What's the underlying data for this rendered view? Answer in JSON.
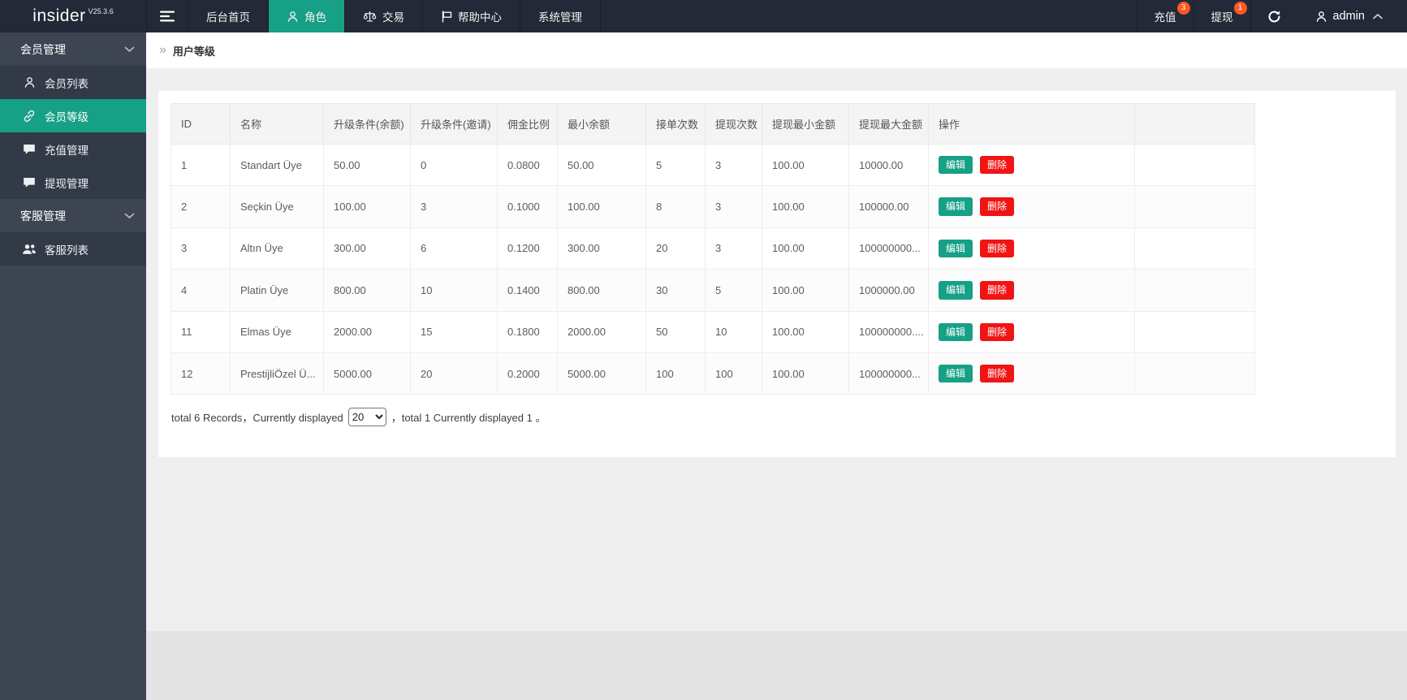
{
  "topbar": {
    "logo_text": "insider",
    "version": "V25.3.6",
    "nav": [
      {
        "label": "后台首页"
      },
      {
        "label": "角色",
        "active": true
      },
      {
        "label": "交易"
      },
      {
        "label": "帮助中心"
      },
      {
        "label": "系统管理"
      }
    ],
    "actions": [
      {
        "label": "充值",
        "badge": "3"
      },
      {
        "label": "提现",
        "badge": "1"
      }
    ],
    "user": "admin"
  },
  "sidebar": {
    "groups": [
      {
        "label": "会员管理",
        "items": [
          {
            "label": "会员列表"
          },
          {
            "label": "会员等级",
            "active": true
          },
          {
            "label": "充值管理"
          },
          {
            "label": "提现管理"
          }
        ]
      },
      {
        "label": "客服管理",
        "items": [
          {
            "label": "客服列表"
          }
        ]
      }
    ]
  },
  "breadcrumb": {
    "arrow": "»",
    "title": "用户等级"
  },
  "table": {
    "headers": [
      "ID",
      "名称",
      "升级条件(余额)",
      "升级条件(邀请)",
      "佣金比例",
      "最小余额",
      "接单次数",
      "提现次数",
      "提现最小金额",
      "提现最大金额",
      "操作"
    ],
    "rows": [
      {
        "id": "1",
        "name": "Standart Üye",
        "upgrade_balance": "50.00",
        "upgrade_invite": "0",
        "commission": "0.0800",
        "min_balance": "50.00",
        "orders": "5",
        "withdraw_times": "3",
        "withdraw_min": "100.00",
        "withdraw_max": "10000.00"
      },
      {
        "id": "2",
        "name": "Seçkin Üye",
        "upgrade_balance": "100.00",
        "upgrade_invite": "3",
        "commission": "0.1000",
        "min_balance": "100.00",
        "orders": "8",
        "withdraw_times": "3",
        "withdraw_min": "100.00",
        "withdraw_max": "100000.00"
      },
      {
        "id": "3",
        "name": "Altın Üye",
        "upgrade_balance": "300.00",
        "upgrade_invite": "6",
        "commission": "0.1200",
        "min_balance": "300.00",
        "orders": "20",
        "withdraw_times": "3",
        "withdraw_min": "100.00",
        "withdraw_max": "100000000..."
      },
      {
        "id": "4",
        "name": "Platin Üye",
        "upgrade_balance": "800.00",
        "upgrade_invite": "10",
        "commission": "0.1400",
        "min_balance": "800.00",
        "orders": "30",
        "withdraw_times": "5",
        "withdraw_min": "100.00",
        "withdraw_max": "1000000.00"
      },
      {
        "id": "11",
        "name": "Elmas Üye",
        "upgrade_balance": "2000.00",
        "upgrade_invite": "15",
        "commission": "0.1800",
        "min_balance": "2000.00",
        "orders": "50",
        "withdraw_times": "10",
        "withdraw_min": "100.00",
        "withdraw_max": "100000000...."
      },
      {
        "id": "12",
        "name": "PrestijliÖzel Ü...",
        "upgrade_balance": "5000.00",
        "upgrade_invite": "20",
        "commission": "0.2000",
        "min_balance": "5000.00",
        "orders": "100",
        "withdraw_times": "100",
        "withdraw_min": "100.00",
        "withdraw_max": "100000000..."
      }
    ],
    "edit_label": "编辑",
    "delete_label": "删除"
  },
  "footer": {
    "text_before": "total 6 Records，Currently displayed",
    "page_size": "20",
    "text_after": "，total 1 Currently displayed 1 。"
  },
  "colors": {
    "accent": "#16a085",
    "danger": "#f01414",
    "badge": "#ff5722",
    "topbar": "#232936",
    "sidebar": "#3d4452",
    "sidebar_item": "#333a47"
  }
}
